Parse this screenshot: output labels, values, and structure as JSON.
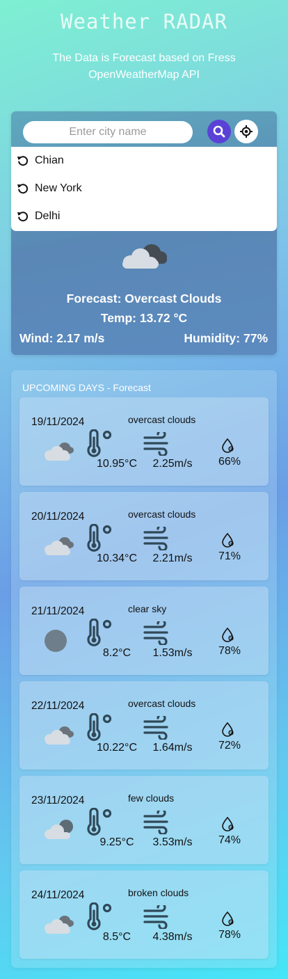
{
  "header": {
    "title": "Weather RADAR",
    "subtitle": "The Data is Forecast based on Fress OpenWeatherMap API"
  },
  "search": {
    "placeholder": "Enter city name",
    "value": ""
  },
  "icons": {
    "search": "search-icon",
    "locate": "crosshair-icon",
    "history": "history-icon"
  },
  "suggestions": [
    "Chian",
    "New York",
    "Delhi"
  ],
  "current": {
    "forecast": "Forecast: Overcast Clouds",
    "temp": "Temp: 13.72 °C",
    "wind": "Wind: 2.17 m/s",
    "humidity": "Humidity: 77%"
  },
  "forecast": {
    "heading": "UPCOMING DAYS - Forecast",
    "days": [
      {
        "date": "19/11/2024",
        "desc": "overcast clouds",
        "temp": "10.95°C",
        "wind": "2.25m/s",
        "humidity": "66%",
        "icon": "overcast-cloud-icon"
      },
      {
        "date": "20/11/2024",
        "desc": "overcast clouds",
        "temp": "10.34°C",
        "wind": "2.21m/s",
        "humidity": "71%",
        "icon": "overcast-cloud-icon"
      },
      {
        "date": "21/11/2024",
        "desc": "clear sky",
        "temp": "8.2°C",
        "wind": "1.53m/s",
        "humidity": "78%",
        "icon": "sun-icon"
      },
      {
        "date": "22/11/2024",
        "desc": "overcast clouds",
        "temp": "10.22°C",
        "wind": "1.64m/s",
        "humidity": "72%",
        "icon": "overcast-cloud-icon"
      },
      {
        "date": "23/11/2024",
        "desc": "few clouds",
        "temp": "9.25°C",
        "wind": "3.53m/s",
        "humidity": "74%",
        "icon": "few-clouds-icon"
      },
      {
        "date": "24/11/2024",
        "desc": "broken clouds",
        "temp": "8.5°C",
        "wind": "4.38m/s",
        "humidity": "78%",
        "icon": "broken-clouds-icon"
      }
    ]
  },
  "colors": {
    "search_button": "#5b42d6",
    "icon_stroke": "#2f4858"
  }
}
